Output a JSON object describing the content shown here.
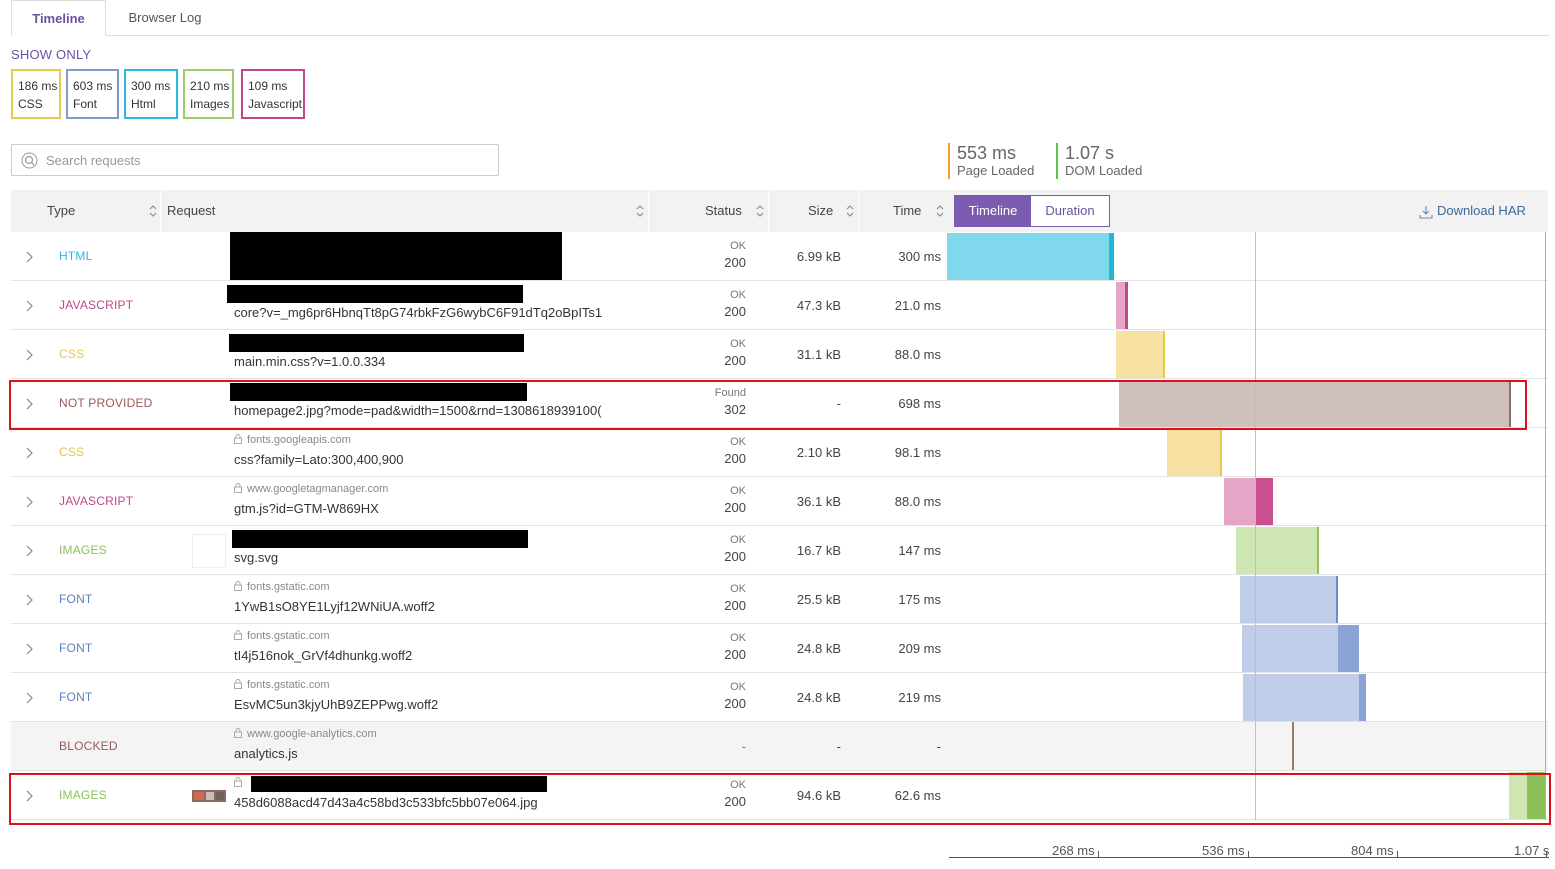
{
  "tabs": [
    {
      "label": "Timeline",
      "active": true
    },
    {
      "label": "Browser Log",
      "active": false
    }
  ],
  "show_only_label": "SHOW ONLY",
  "filters": [
    {
      "ms": "186 ms",
      "label": "CSS",
      "color": "#e6c84a"
    },
    {
      "ms": "603 ms",
      "label": "Font",
      "color": "#7f9ad0"
    },
    {
      "ms": "300 ms",
      "label": "Html",
      "color": "#2cb8dc"
    },
    {
      "ms": "210 ms",
      "label": "Images",
      "color": "#9ccc6b"
    },
    {
      "ms": "109 ms",
      "label": "Javascript",
      "color": "#c0478a"
    }
  ],
  "search": {
    "placeholder": "Search requests"
  },
  "metrics": [
    {
      "value": "553 ms",
      "label": "Page Loaded",
      "color": "#f0a030"
    },
    {
      "value": "1.07 s",
      "label": "DOM Loaded",
      "color": "#5fc24a"
    }
  ],
  "columns": {
    "type": "Type",
    "request": "Request",
    "status": "Status",
    "size": "Size",
    "time": "Time"
  },
  "view_toggle": {
    "timeline": "Timeline",
    "duration": "Duration",
    "selected": "Timeline"
  },
  "download_har": "Download HAR",
  "type_colors": {
    "HTML": "#2cb8dc",
    "JAVASCRIPT": "#c0478a",
    "CSS": "#e6c84a",
    "NOT PROVIDED": "#9a5a5a",
    "IMAGES": "#8cc15a",
    "FONT": "#5b7fc4",
    "BLOCKED": "#9a5a5a"
  },
  "requests": [
    {
      "type": "HTML",
      "host": "",
      "path": "",
      "status_text": "OK",
      "status_code": "200",
      "size": "6.99 kB",
      "time": "300 ms",
      "secure": false
    },
    {
      "type": "JAVASCRIPT",
      "host": "",
      "path": "core?v=_mg6pr6HbnqTt8pG74rbkFzG6wybC6F91dTq2oBpITs1",
      "status_text": "OK",
      "status_code": "200",
      "size": "47.3 kB",
      "time": "21.0 ms",
      "secure": false
    },
    {
      "type": "CSS",
      "host": "",
      "path": "main.min.css?v=1.0.0.334",
      "status_text": "OK",
      "status_code": "200",
      "size": "31.1 kB",
      "time": "88.0 ms",
      "secure": false
    },
    {
      "type": "NOT PROVIDED",
      "host": "",
      "path": "homepage2.jpg?mode=pad&width=1500&rnd=1308618939100(",
      "status_text": "Found",
      "status_code": "302",
      "size": "-",
      "time": "698 ms",
      "secure": false
    },
    {
      "type": "CSS",
      "host": "fonts.googleapis.com",
      "path": "css?family=Lato:300,400,900",
      "status_text": "OK",
      "status_code": "200",
      "size": "2.10 kB",
      "time": "98.1 ms",
      "secure": true
    },
    {
      "type": "JAVASCRIPT",
      "host": "www.googletagmanager.com",
      "path": "gtm.js?id=GTM-W869HX",
      "status_text": "OK",
      "status_code": "200",
      "size": "36.1 kB",
      "time": "88.0 ms",
      "secure": true
    },
    {
      "type": "IMAGES",
      "host": "",
      "path": "svg.svg",
      "status_text": "OK",
      "status_code": "200",
      "size": "16.7 kB",
      "time": "147 ms",
      "secure": false
    },
    {
      "type": "FONT",
      "host": "fonts.gstatic.com",
      "path": "1YwB1sO8YE1Lyjf12WNiUA.woff2",
      "status_text": "OK",
      "status_code": "200",
      "size": "25.5 kB",
      "time": "175 ms",
      "secure": true
    },
    {
      "type": "FONT",
      "host": "fonts.gstatic.com",
      "path": "tI4j516nok_GrVf4dhunkg.woff2",
      "status_text": "OK",
      "status_code": "200",
      "size": "24.8 kB",
      "time": "209 ms",
      "secure": true
    },
    {
      "type": "FONT",
      "host": "fonts.gstatic.com",
      "path": "EsvMC5un3kjyUhB9ZEPPwg.woff2",
      "status_text": "OK",
      "status_code": "200",
      "size": "24.8 kB",
      "time": "219 ms",
      "secure": true
    },
    {
      "type": "BLOCKED",
      "host": "www.google-analytics.com",
      "path": "analytics.js",
      "status_text": "",
      "status_code": "-",
      "size": "-",
      "time": "-",
      "secure": true
    },
    {
      "type": "IMAGES",
      "host": "",
      "path": "458d6088acd47d43a4c58bd3c533bfc5bb07e064.jpg",
      "status_text": "OK",
      "status_code": "200",
      "size": "94.6 kB",
      "time": "62.6 ms",
      "secure": true
    }
  ],
  "timeline": {
    "axis_ticks": [
      "268 ms",
      "536 ms",
      "804 ms",
      "1.07 s"
    ],
    "page_loaded_ms": 553,
    "dom_loaded_ms": 1070
  }
}
